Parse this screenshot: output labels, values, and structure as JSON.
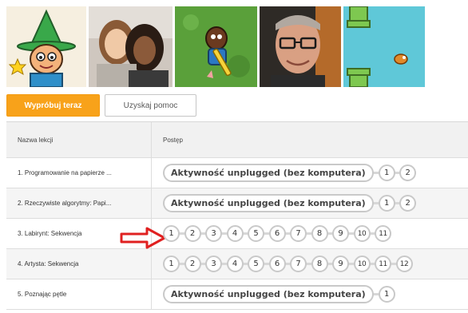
{
  "buttons": {
    "try_label": "Wypróbuj teraz",
    "help_label": "Uzyskaj pomoc"
  },
  "colors": {
    "accent": "#f8a21a",
    "arrow": "#e02020",
    "bubble_border": "#c9c9c9"
  },
  "table": {
    "headers": {
      "name": "Nazwa lekcji",
      "progress": "Postęp"
    },
    "rows": [
      {
        "name": "1. Programowanie na papierze ...",
        "pill": "Aktywność unplugged (bez komputera)",
        "levels": [
          "1",
          "2"
        ]
      },
      {
        "name": "2. Rzeczywiste algorytmy: Papi...",
        "pill": "Aktywność unplugged (bez komputera)",
        "levels": [
          "1",
          "2"
        ]
      },
      {
        "name": "3. Labirynt: Sekwencja",
        "pill": "",
        "levels": [
          "1",
          "2",
          "3",
          "4",
          "5",
          "6",
          "7",
          "8",
          "9",
          "10",
          "11"
        ]
      },
      {
        "name": "4. Artysta: Sekwencja",
        "pill": "",
        "levels": [
          "1",
          "2",
          "3",
          "4",
          "5",
          "6",
          "7",
          "8",
          "9",
          "10",
          "11",
          "12"
        ]
      },
      {
        "name": "5. Poznając pętle",
        "pill": "Aktywność unplugged (bez komputera)",
        "levels": [
          "1"
        ]
      }
    ]
  },
  "thumbnails": [
    "wizard-character",
    "two-girls-photo",
    "avatar-character-game",
    "man-with-glasses-photo",
    "flappy-game"
  ],
  "pointer": "red-arrow-icon"
}
